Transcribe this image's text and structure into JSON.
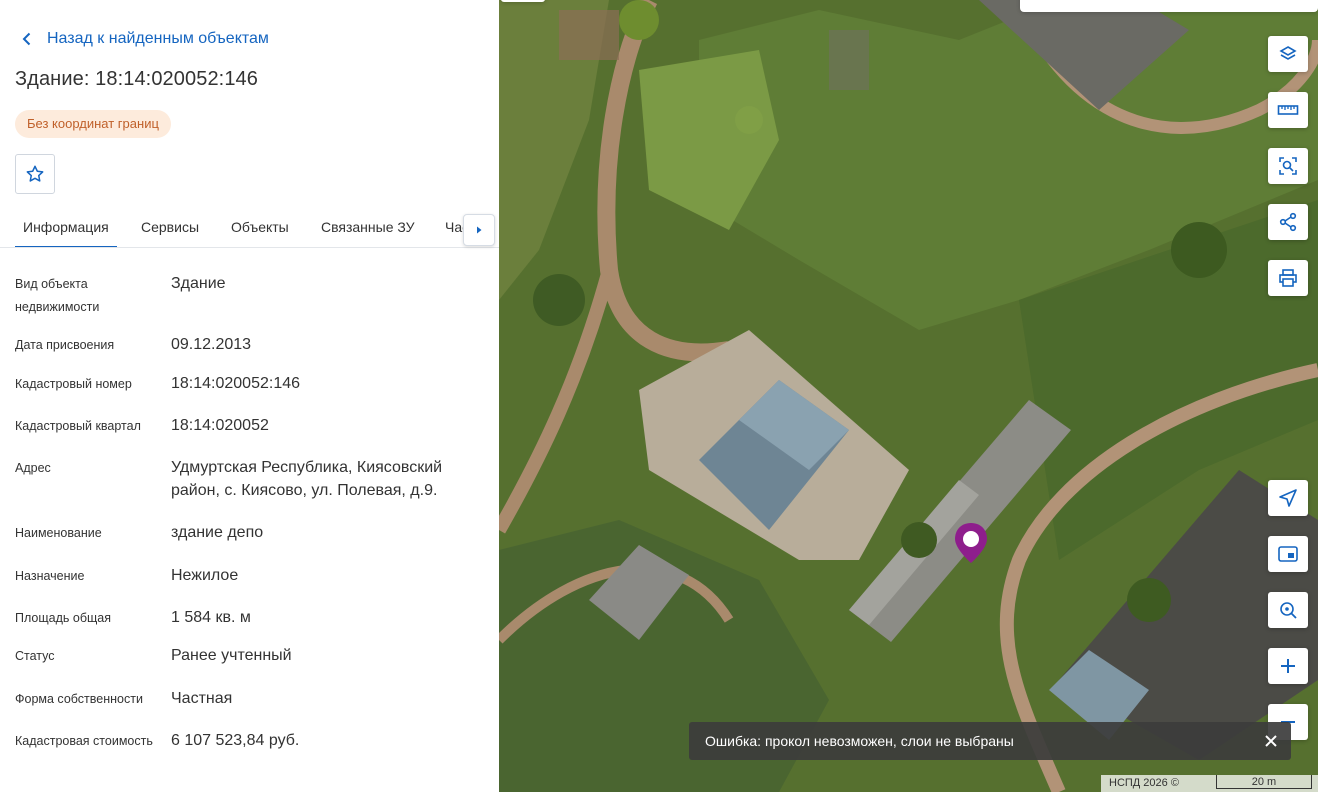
{
  "panel": {
    "back_label": "Назад к найденным объектам",
    "title": "Здание: 18:14:020052:146",
    "badge": "Без координат границ",
    "tabs": [
      {
        "label": "Информация",
        "active": true
      },
      {
        "label": "Сервисы",
        "active": false
      },
      {
        "label": "Объекты",
        "active": false
      },
      {
        "label": "Связанные ЗУ",
        "active": false
      },
      {
        "label": "Части",
        "active": false
      }
    ],
    "rows": [
      {
        "label": "Вид объекта недвижимости",
        "value": "Здание"
      },
      {
        "label": "Дата присвоения",
        "value": "09.12.2013"
      },
      {
        "label": "Кадастровый номер",
        "value": "18:14:020052:146"
      },
      {
        "label": "Кадастровый квартал",
        "value": "18:14:020052"
      },
      {
        "label": "Адрес",
        "value": "Удмуртская Республика, Киясовский район, с. Киясово, ул. Полевая, д.9."
      },
      {
        "label": "Наименование",
        "value": "здание депо"
      },
      {
        "label": "Назначение",
        "value": "Нежилое"
      },
      {
        "label": "Площадь общая",
        "value": "1 584 кв. м"
      },
      {
        "label": "Статус",
        "value": "Ранее учтенный"
      },
      {
        "label": "Форма собственности",
        "value": "Частная"
      },
      {
        "label": "Кадастровая стоимость",
        "value": "6 107 523,84 руб."
      }
    ]
  },
  "map": {
    "toast": "Ошибка: прокол невозможен, слои не выбраны",
    "attribution": "НСПД 2026 ©",
    "scale": "20 m",
    "tools": [
      "layers-icon",
      "ruler-icon",
      "select-area-icon",
      "share-icon",
      "print-icon",
      "locate-icon",
      "minimap-icon",
      "search-location-icon",
      "zoom-in-icon",
      "zoom-out-icon"
    ],
    "marker_color": "#8e1e8c"
  },
  "colors": {
    "accent": "#1565c0",
    "badge_bg": "#fdebdc",
    "badge_text": "#c0602a"
  }
}
